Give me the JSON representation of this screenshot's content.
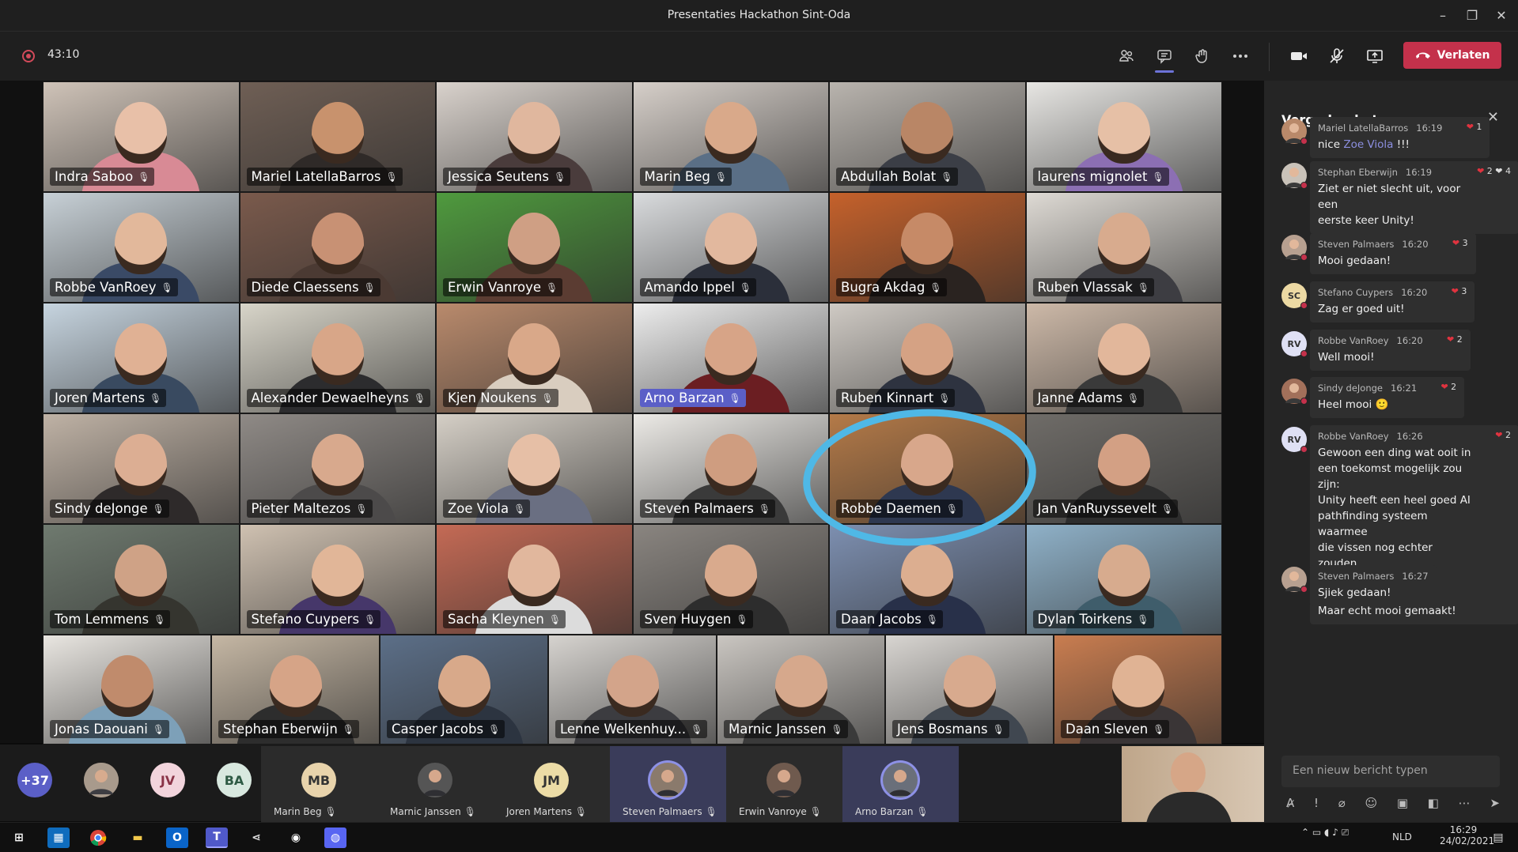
{
  "window": {
    "title": "Presentaties Hackathon Sint-Oda",
    "minimize": "–",
    "restore": "❐",
    "close": "✕"
  },
  "toolbar": {
    "timer": "43:10",
    "leave_label": "Verlaten"
  },
  "grid": {
    "tiles": [
      {
        "name": "Indra Saboo",
        "skin": "#e8c0a8",
        "wall": "#cfc3b8",
        "shirt": "#d88a95"
      },
      {
        "name": "Mariel LatellaBarros",
        "skin": "#c8926d",
        "wall": "#6f5f55",
        "shirt": "#2f2a28"
      },
      {
        "name": "Jessica Seutens",
        "skin": "#e0b79e",
        "wall": "#d9d2cc",
        "shirt": "#4a3c3c"
      },
      {
        "name": "Marin Beg",
        "skin": "#d9a98a",
        "wall": "#d6cfc9",
        "shirt": "#5a6f86"
      },
      {
        "name": "Abdullah Bolat",
        "skin": "#b98666",
        "wall": "#b9b4ae",
        "shirt": "#3b3e46"
      },
      {
        "name": "laurens mignolet",
        "skin": "#e6c0a6",
        "wall": "#e7e6e3",
        "shirt": "#8c6fb3"
      },
      {
        "name": "Robbe VanRoey",
        "skin": "#e2b89b",
        "wall": "#c7d0d6",
        "shirt": "#3a4a66"
      },
      {
        "name": "Diede Claessens",
        "skin": "#c89174",
        "wall": "#7a5a4c",
        "shirt": "#4b3a33"
      },
      {
        "name": "Erwin Vanroye",
        "skin": "#cf9f84",
        "wall": "#4f9a3e",
        "shirt": "#5b3c32"
      },
      {
        "name": "Amando Ippel",
        "skin": "#e2b89e",
        "wall": "#d9dbdd",
        "shirt": "#2b2f3a"
      },
      {
        "name": "Bugra Akdag",
        "skin": "#c68a67",
        "wall": "#c5612b",
        "shirt": "#2a2320"
      },
      {
        "name": "Ruben Vlassak",
        "skin": "#d8ab8e",
        "wall": "#dedad4",
        "shirt": "#3d3d42"
      },
      {
        "name": "Joren Martens",
        "skin": "#e0b194",
        "wall": "#c6d4df",
        "shirt": "#394a60"
      },
      {
        "name": "Alexander Dewaelheyns",
        "skin": "#d8a688",
        "wall": "#d8d5c9",
        "shirt": "#2c2c2e"
      },
      {
        "name": "Kjen Noukens",
        "skin": "#d9a889",
        "wall": "#b98a6c",
        "shirt": "#d9cdbf"
      },
      {
        "name": "Arno Barzan",
        "skin": "#d7a487",
        "wall": "#ededed",
        "shirt": "#6b1e22",
        "highlight": true
      },
      {
        "name": "Ruben Kinnart",
        "skin": "#d5a284",
        "wall": "#cfcac4",
        "shirt": "#2e3340"
      },
      {
        "name": "Janne Adams",
        "skin": "#e2b79b",
        "wall": "#cdb9a8",
        "shirt": "#3a3a3a"
      },
      {
        "name": "Sindy deJonge",
        "skin": "#dcae93",
        "wall": "#bfb2a5",
        "shirt": "#2e2a2a"
      },
      {
        "name": "Pieter Maltezos",
        "skin": "#d8a98d",
        "wall": "#8f8a86",
        "shirt": "#4c4a4a"
      },
      {
        "name": "Zoe Viola",
        "skin": "#e6bfa6",
        "wall": "#d5cfc6",
        "shirt": "#6a6f82"
      },
      {
        "name": "Steven Palmaers",
        "skin": "#cf9d80",
        "wall": "#eceae6",
        "shirt": "#3a3a3a"
      },
      {
        "name": "Robbe Daemen",
        "skin": "#d8a78b",
        "wall": "#b47a48",
        "shirt": "#2e3850"
      },
      {
        "name": "Jan VanRuyssevelt",
        "skin": "#d3a084",
        "wall": "#6f6c68",
        "shirt": "#2d2d2d"
      },
      {
        "name": "Tom Lemmens",
        "skin": "#cfa286",
        "wall": "#6f7a6f",
        "shirt": "#35352f"
      },
      {
        "name": "Stefano Cuypers",
        "skin": "#e1b698",
        "wall": "#cfc1b1",
        "shirt": "#46376a"
      },
      {
        "name": "Sacha Kleynen",
        "skin": "#e1b79d",
        "wall": "#c46a55",
        "shirt": "#dcdcdc"
      },
      {
        "name": "Sven Huygen",
        "skin": "#d9aa8d",
        "wall": "#8a8580",
        "shirt": "#2d2d2d"
      },
      {
        "name": "Daan Jacobs",
        "skin": "#dcae90",
        "wall": "#7d8fb0",
        "shirt": "#283049"
      },
      {
        "name": "Dylan Toirkens",
        "skin": "#d7ab8e",
        "wall": "#8fb1c8",
        "shirt": "#3f5d6b"
      },
      {
        "name": "Jonas Daouani",
        "skin": "#c08b6c",
        "wall": "#e9e6e1",
        "shirt": "#7da0b8"
      },
      {
        "name": "Stephan Eberwijn",
        "skin": "#d6a487",
        "wall": "#c5b7a4",
        "shirt": "#2d2d2d"
      },
      {
        "name": "Casper Jacobs",
        "skin": "#d8a98a",
        "wall": "#5c6f88",
        "shirt": "#2c3440"
      },
      {
        "name": "Lenne Welkenhuy...",
        "skin": "#d3a48a",
        "wall": "#d6d3cf",
        "shirt": "#3c3c40"
      },
      {
        "name": "Marnic Janssen",
        "skin": "#d6a88c",
        "wall": "#cac6c1",
        "shirt": "#3a3a3a"
      },
      {
        "name": "Jens Bosmans",
        "skin": "#d8aa8e",
        "wall": "#d8d5d1",
        "shirt": "#404750"
      },
      {
        "name": "Daan Sleven",
        "skin": "#e0b394",
        "wall": "#c97d50",
        "shirt": "#3a3536"
      }
    ]
  },
  "strip": {
    "overflow": "+37",
    "bubbles": [
      "JV",
      "BA"
    ],
    "cards": [
      {
        "name": "Marin Beg",
        "initials": "MB",
        "color": "#e8d3ab",
        "photo": false,
        "active": false
      },
      {
        "name": "Marnic Janssen",
        "initials": "",
        "color": "#555555",
        "photo": true,
        "active": false
      },
      {
        "name": "Joren Martens",
        "initials": "JM",
        "color": "#ecdca6",
        "photo": false,
        "active": false
      },
      {
        "name": "Steven Palmaers",
        "initials": "",
        "color": "#8a7a6c",
        "photo": true,
        "active": true
      },
      {
        "name": "Erwin Vanroye",
        "initials": "",
        "color": "#6f5a4e",
        "photo": true,
        "active": false
      },
      {
        "name": "Arno Barzan",
        "initials": "",
        "color": "#6a6f7a",
        "photo": true,
        "active": true
      }
    ]
  },
  "chat": {
    "title": "Vergaderchat",
    "compose_placeholder": "Een nieuw bericht typen",
    "messages": [
      {
        "author": "Mariel LatellaBarros",
        "time": "16:19",
        "react": "1",
        "text_pre": "nice ",
        "mention": "Zoe Viola",
        "text_post": " !!!",
        "initials": "",
        "avcolor": "#b9896a"
      },
      {
        "author": "Stephan Eberwijn",
        "time": "16:19",
        "react": "2 ❤ 4",
        "text": "Ziet er niet slecht uit, voor een\neerste keer Unity!",
        "initials": "",
        "avcolor": "#c9c2b9"
      },
      {
        "author": "Steven Palmaers",
        "time": "16:20",
        "react": "3",
        "text": "Mooi gedaan!",
        "initials": "",
        "avcolor": "#b7a090"
      },
      {
        "author": "Stefano Cuypers",
        "time": "16:20",
        "react": "3",
        "text": "Zag er goed uit!",
        "initials": "SC",
        "avcolor": "#ecd9a3"
      },
      {
        "author": "Robbe VanRoey",
        "time": "16:20",
        "react": "2",
        "text": "Well mooi!",
        "initials": "RV",
        "avcolor": "#dfe0f4"
      },
      {
        "author": "Sindy deJonge",
        "time": "16:21",
        "react": "2",
        "text": "Heel mooi 🙂",
        "initials": "",
        "avcolor": "#a2705a"
      },
      {
        "author": "Robbe VanRoey",
        "time": "16:26",
        "react": "2",
        "text": "Gewoon een ding wat ooit in\neen toekomst mogelijk zou zijn:\nUnity heeft een heel goed AI\npathfinding systeem waarmee\ndie vissen nog echter zouden\nkunnen bewegen 😉\n\nMaar echt mooi gemaakt!",
        "initials": "RV",
        "avcolor": "#dfe0f4"
      },
      {
        "author": "Steven Palmaers",
        "time": "16:27",
        "react": "",
        "text": "Sjiek gedaan!",
        "initials": "",
        "avcolor": "#b7a090"
      }
    ]
  },
  "taskbar": {
    "lang": "NLD",
    "time": "16:29",
    "date": "24/02/2021"
  },
  "colors": {
    "accent": "#5b5fc7",
    "leave": "#c4314b",
    "circle": "#4fb8e6"
  }
}
